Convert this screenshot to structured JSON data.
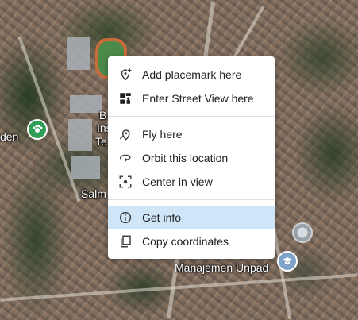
{
  "map": {
    "labels": {
      "left_partial": "den",
      "building_partial": [
        "B",
        "Ins",
        "Te"
      ],
      "place_partial": "Salm",
      "bottom": "Manajemen Unpad"
    },
    "pins": [
      {
        "icon": "park-pin-icon",
        "color": "#2f9e55"
      },
      {
        "icon": "school-pin-icon",
        "color": "#7fa3c9"
      }
    ]
  },
  "context_menu": {
    "groups": [
      [
        {
          "icon": "add-placemark-icon",
          "label": "Add placemark here"
        },
        {
          "icon": "street-view-icon",
          "label": "Enter Street View here"
        }
      ],
      [
        {
          "icon": "fly-here-icon",
          "label": "Fly here"
        },
        {
          "icon": "orbit-icon",
          "label": "Orbit this location"
        },
        {
          "icon": "center-view-icon",
          "label": "Center in view"
        }
      ],
      [
        {
          "icon": "info-icon",
          "label": "Get info",
          "highlighted": true
        },
        {
          "icon": "copy-icon",
          "label": "Copy coordinates"
        }
      ]
    ],
    "highlight_color": "#cfe6f9"
  }
}
